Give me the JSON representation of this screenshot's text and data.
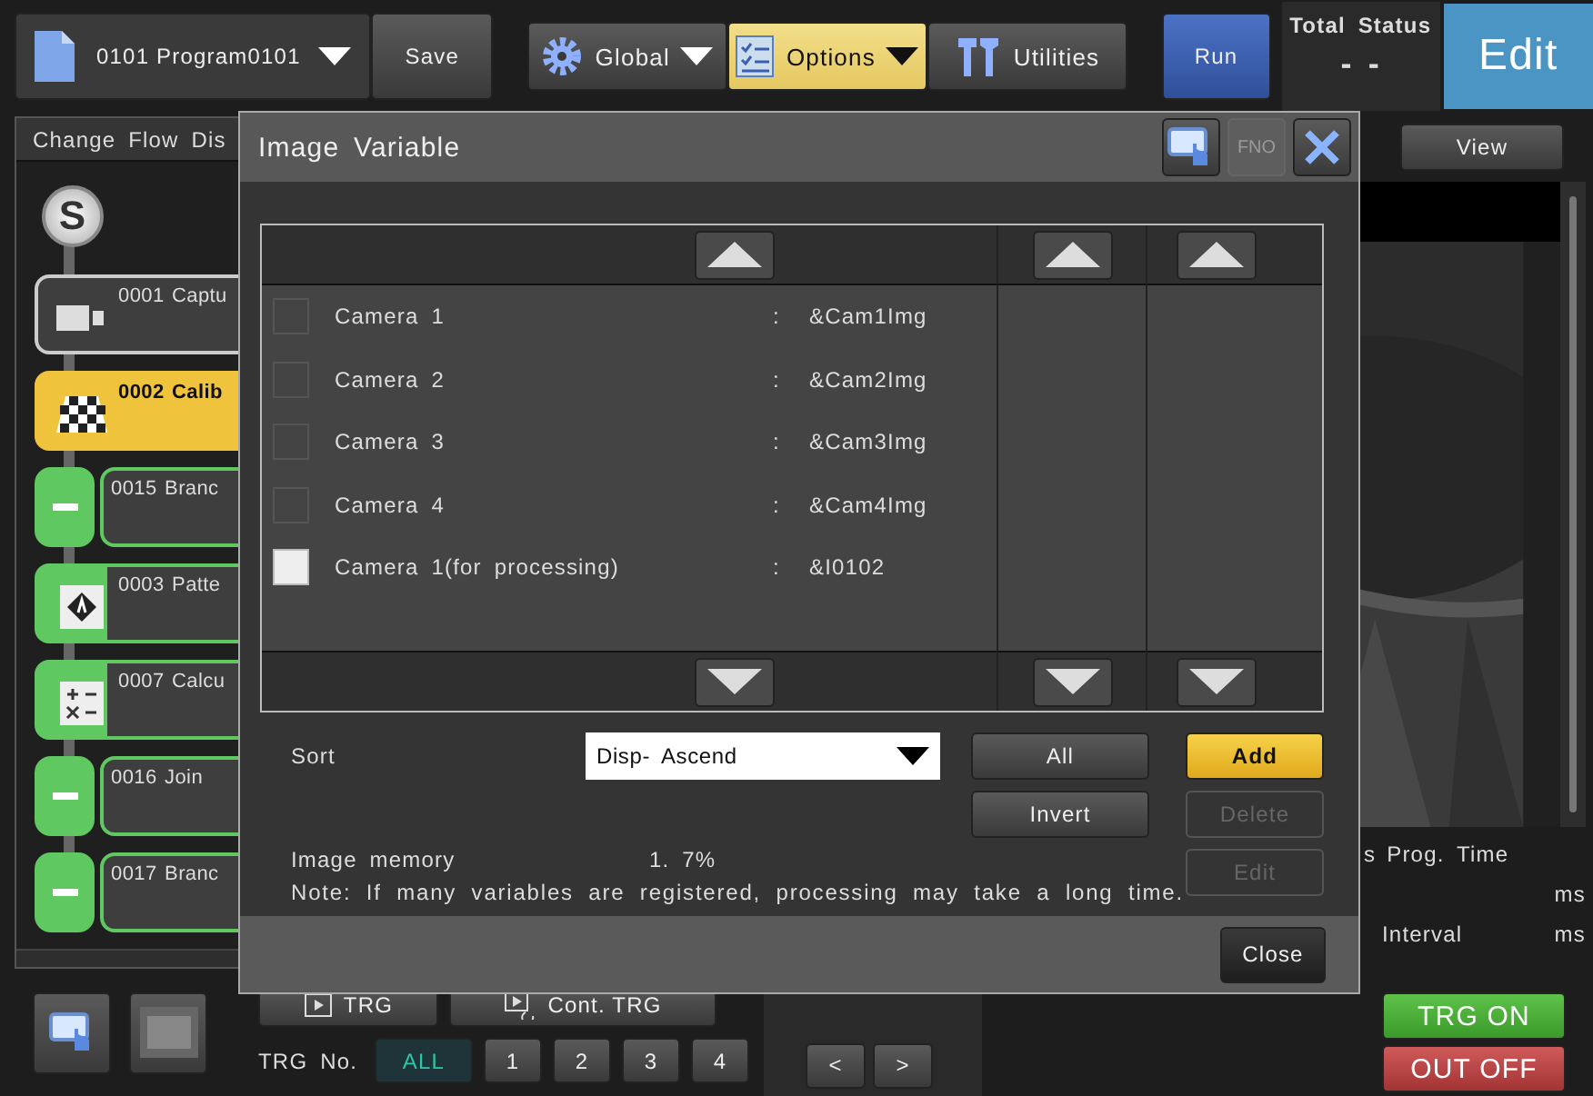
{
  "toolbar": {
    "program": "0101 Program0101",
    "save_button": "Save",
    "menus": [
      {
        "kind": "global",
        "label": "Global",
        "selected": false,
        "dropdown": true
      },
      {
        "kind": "options",
        "label": "Options",
        "selected": true,
        "dropdown": true
      },
      {
        "kind": "utilities",
        "label": "Utilities",
        "selected": false,
        "dropdown": false
      }
    ],
    "run_button": "Run",
    "total_status": {
      "label": "Total Status",
      "value": "- -"
    },
    "mode_button": "Edit"
  },
  "flow_panel": {
    "title": "Change Flow Dis",
    "start": "S",
    "items": [
      {
        "kind": "capture",
        "label": "0001 Captu",
        "selected": false
      },
      {
        "kind": "calibration",
        "label": "0002 Calib",
        "selected": true
      },
      {
        "kind": "branch",
        "label": "0015 Branc",
        "selected": false
      },
      {
        "kind": "pattern",
        "label": "0003 Patte",
        "selected": false
      },
      {
        "kind": "calculation",
        "label": "0007 Calcu",
        "selected": false
      },
      {
        "kind": "branch",
        "label": "0016 Join",
        "selected": false
      },
      {
        "kind": "branch",
        "label": "0017 Branc",
        "selected": false
      }
    ]
  },
  "trigger": {
    "buttons": [
      {
        "kind": "single",
        "label": "TRG"
      },
      {
        "kind": "continuous",
        "label": "Cont. TRG"
      }
    ],
    "number_label": "TRG No.",
    "numbers": [
      {
        "label": "ALL",
        "selected": true
      },
      {
        "label": "1",
        "selected": false
      },
      {
        "label": "2",
        "selected": false
      },
      {
        "label": "3",
        "selected": false
      },
      {
        "label": "4",
        "selected": false
      }
    ]
  },
  "nav_buttons": [
    "<",
    ">"
  ],
  "image_panel": {
    "view_button": "View",
    "cut_text": "s",
    "prog_time_label": "Prog. Time",
    "prog_time_unit": "ms",
    "interval_label": "Interval",
    "interval_unit": "ms",
    "trg_on_button": "TRG ON",
    "out_off_button": "OUT OFF"
  },
  "dialog": {
    "title": "Image Variable",
    "fno_button": {
      "label": "FNO",
      "disabled": true
    },
    "variables": [
      {
        "name": "Camera 1",
        "separator": ":",
        "value": "&Cam1Img",
        "checked": false
      },
      {
        "name": "Camera 2",
        "separator": ":",
        "value": "&Cam2Img",
        "checked": false
      },
      {
        "name": "Camera 3",
        "separator": ":",
        "value": "&Cam3Img",
        "checked": false
      },
      {
        "name": "Camera 4",
        "separator": ":",
        "value": "&Cam4Img",
        "checked": false
      },
      {
        "name": "Camera 1(for processing)",
        "separator": ":",
        "value": "&I0102",
        "checked": true
      }
    ],
    "sort": {
      "label": "Sort",
      "value": "Disp- Ascend"
    },
    "all_button": "All",
    "invert_button": "Invert",
    "side_buttons": [
      {
        "kind": "primary",
        "label": "Add",
        "disabled": false
      },
      {
        "kind": "normal",
        "label": "Delete",
        "disabled": true
      },
      {
        "kind": "normal",
        "label": "Edit",
        "disabled": true
      }
    ],
    "memory": {
      "label": "Image memory",
      "value": "1. 7%"
    },
    "note": "Note: If many variables are registered, processing may take a long time.",
    "close_button": "Close"
  }
}
